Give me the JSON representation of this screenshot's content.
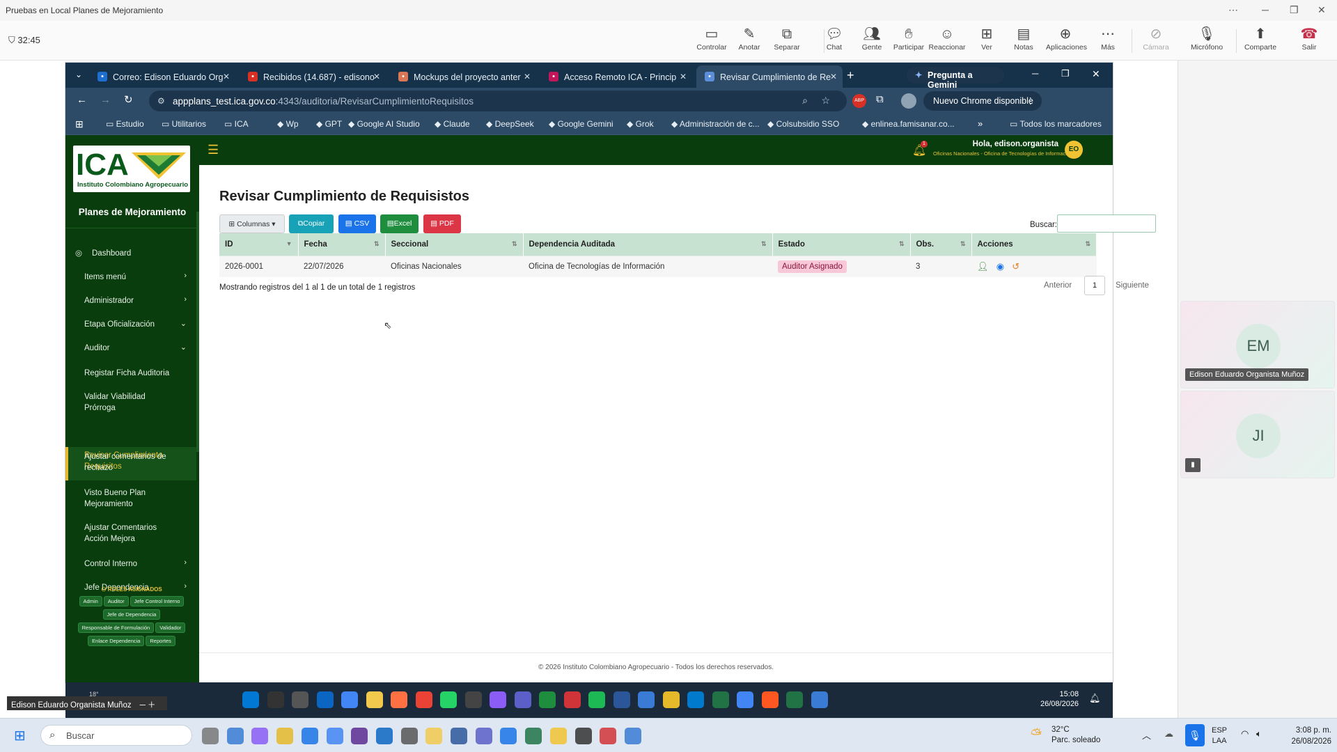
{
  "teams": {
    "window_title": "Pruebas en Local Planes de Mejoramiento",
    "timer": "32:45",
    "toolbar": [
      {
        "label": "Controlar",
        "icon": "monitor-icon"
      },
      {
        "label": "Anotar",
        "icon": "pen-icon"
      },
      {
        "label": "Separar",
        "icon": "popout-icon"
      },
      {
        "label": "Chat",
        "icon": "chat-icon"
      },
      {
        "label": "Gente",
        "icon": "people-icon",
        "badge": "2"
      },
      {
        "label": "Participar",
        "icon": "hand-icon"
      },
      {
        "label": "Reaccionar",
        "icon": "smile-icon"
      },
      {
        "label": "Ver",
        "icon": "grid-icon"
      },
      {
        "label": "Notas",
        "icon": "notes-icon"
      },
      {
        "label": "Aplicaciones",
        "icon": "plus-icon"
      },
      {
        "label": "Más",
        "icon": "more-icon"
      },
      {
        "label": "Cámara",
        "icon": "camera-off-icon"
      },
      {
        "label": "Micrófono",
        "icon": "mic-icon"
      },
      {
        "label": "Comparte",
        "icon": "share-icon"
      },
      {
        "label": "Salir",
        "icon": "hangup-icon"
      }
    ],
    "participants": [
      {
        "initials": "EM",
        "name": "Edison Eduardo Organista Muñoz"
      },
      {
        "initials": "JI",
        "name": ""
      }
    ],
    "presenter_label": "Edison Eduardo Organista Muñoz"
  },
  "browser": {
    "tabs": [
      {
        "label": "Correo: Edison Eduardo Org",
        "icon": "outlook-icon",
        "color": "#1f6fd1"
      },
      {
        "label": "Recibidos (14.687) - edisono",
        "icon": "gmail-icon",
        "color": "#d93025"
      },
      {
        "label": "Mockups del proyecto anter",
        "icon": "claude-icon",
        "color": "#d97757"
      },
      {
        "label": "Acceso Remoto ICA - Princip",
        "icon": "remote-icon",
        "color": "#c2185b"
      },
      {
        "label": "Revisar Cumplimiento de Re",
        "icon": "page-icon",
        "color": "#5b8fd9"
      }
    ],
    "gemini_label": "Pregunta a Gemini",
    "url_host": "appplans_test.ica.gov.co",
    "url_path": ":4343/auditoria/RevisarCumplimientoRequisitos",
    "update_label": "Nuevo Chrome disponible",
    "bookmarks": [
      "Estudio",
      "Utilitarios",
      "ICA",
      "Wp",
      "GPT",
      "Google AI Studio",
      "Claude",
      "DeepSeek",
      "Google Gemini",
      "Grok",
      "Administración de c...",
      "Colsubsidio SSO",
      "enlinea.famisanar.co..."
    ],
    "all_bookmarks": "Todos los marcadores"
  },
  "app": {
    "logo_text": "ICA",
    "logo_sub": "Instituto Colombiano Agropecuario",
    "name": "Planes de Mejoramiento",
    "greeting": "Hola, edison.organista",
    "office": "Oficinas Nacionales - Oficina de Tecnologías de Información",
    "user_initials": "EO",
    "notif_count": "1",
    "menu": [
      {
        "label": "Dashboard",
        "chev": ""
      },
      {
        "label": "Items menú",
        "chev": "›"
      },
      {
        "label": "Administrador",
        "chev": "›"
      },
      {
        "label": "Etapa Oficialización",
        "chev": "⌄"
      },
      {
        "label": "Auditor",
        "chev": "⌄"
      },
      {
        "label": "Registar Ficha Auditoria",
        "chev": ""
      },
      {
        "label": "Validar Viabilidad Prórroga",
        "chev": ""
      },
      {
        "label": "Revisar Cumplimiento Requisitos",
        "chev": ""
      },
      {
        "label": "Ajustar comentarios de rechazo",
        "chev": ""
      },
      {
        "label": "Visto Bueno Plan Mejoramiento",
        "chev": ""
      },
      {
        "label": "Ajustar Comentarios Acción Mejora",
        "chev": ""
      },
      {
        "label": "Control Interno",
        "chev": "›"
      },
      {
        "label": "Jefe Dependencia",
        "chev": "›"
      }
    ],
    "roles_title": "ROLES ASIGNADOS",
    "roles": [
      "Admin",
      "Auditor",
      "Jefe Control Interno",
      "Jefe de Dependencia",
      "Responsable de Formulación",
      "Validador",
      "Enlace Dependencia",
      "Reportes"
    ],
    "page_title": "Revisar Cumplimiento de Requisistos",
    "buttons": {
      "columns": "Columnas",
      "copy": "Copiar",
      "csv": "CSV",
      "excel": "Excel",
      "pdf": "PDF"
    },
    "search_label": "Buscar:",
    "table": {
      "headers": [
        "ID",
        "Fecha",
        "Seccional",
        "Dependencia Auditada",
        "Estado",
        "Obs.",
        "Acciones"
      ],
      "rows": [
        {
          "id": "2026-0001",
          "fecha": "22/07/2026",
          "seccional": "Oficinas Nacionales",
          "dependencia": "Oficina de Tecnologías de Información",
          "estado": "Auditor Asignado",
          "obs": "3"
        }
      ]
    },
    "info": "Mostrando registros del 1 al 1 de un total de 1 registros",
    "pager": {
      "prev": "Anterior",
      "page": "1",
      "next": "Siguiente"
    },
    "footer": "© 2026 Instituto Colombiano Agropecuario - Todos los derechos reservados."
  },
  "inner_taskbar": {
    "time": "15:08",
    "date": "26/08/2026",
    "temp": "18°"
  },
  "taskbar": {
    "search_placeholder": "Buscar",
    "weather_temp": "32°C",
    "weather_desc": "Parc. soleado",
    "lang": "ESP",
    "lang2": "LAA",
    "time": "3:08 p. m.",
    "date": "26/08/2026"
  }
}
